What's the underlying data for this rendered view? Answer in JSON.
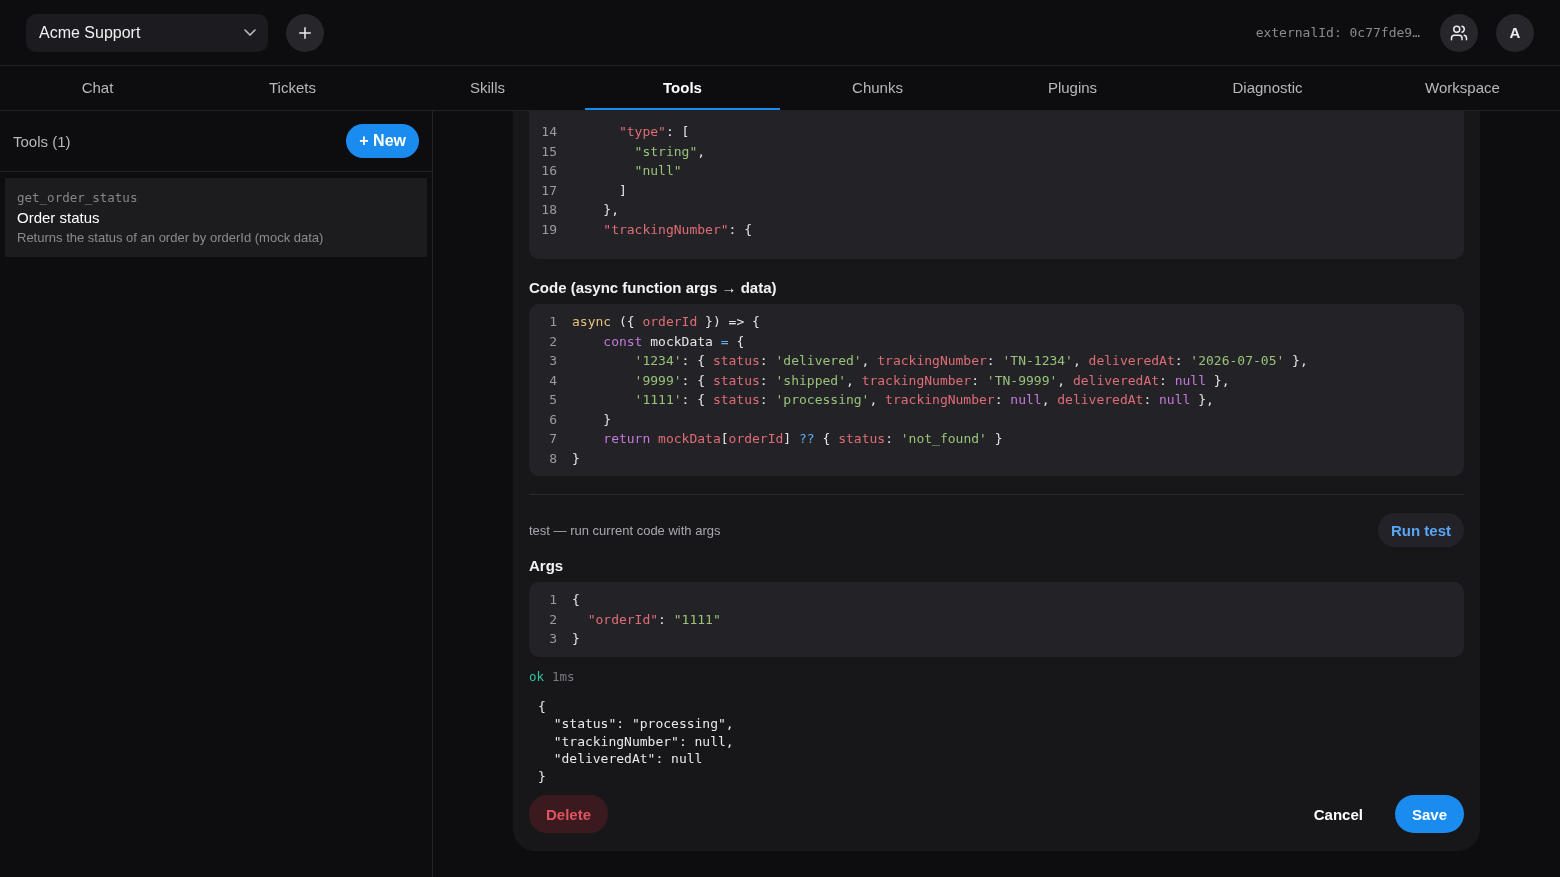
{
  "workspace_select": {
    "value": "Acme Support"
  },
  "external_id": "externalId: 0c77fde9…",
  "avatar": "A",
  "tabs": [
    {
      "label": "Chat",
      "selected": false
    },
    {
      "label": "Tickets",
      "selected": false
    },
    {
      "label": "Skills",
      "selected": false
    },
    {
      "label": "Tools",
      "selected": true
    },
    {
      "label": "Chunks",
      "selected": false
    },
    {
      "label": "Plugins",
      "selected": false
    },
    {
      "label": "Diagnostic",
      "selected": false
    },
    {
      "label": "Workspace",
      "selected": false
    }
  ],
  "sidebar": {
    "title": "Tools (1)",
    "new_button": "+ New",
    "items": [
      {
        "id_text": "get_order_status",
        "name": "Order status",
        "description": "Returns the status of an order by orderId (mock data)",
        "selected": true
      }
    ]
  },
  "schema_editor": {
    "lines": [
      {
        "n": "14",
        "tokens": [
          {
            "kind": "key",
            "text": "      \"type\""
          },
          {
            "kind": "plain",
            "text": ": ["
          }
        ]
      },
      {
        "n": "15",
        "tokens": [
          {
            "kind": "string",
            "text": "        \"string\""
          },
          {
            "kind": "plain",
            "text": ","
          }
        ]
      },
      {
        "n": "16",
        "tokens": [
          {
            "kind": "string",
            "text": "        \"null\""
          }
        ]
      },
      {
        "n": "17",
        "tokens": [
          {
            "kind": "plain",
            "text": "      ]"
          }
        ]
      },
      {
        "n": "18",
        "tokens": [
          {
            "kind": "plain",
            "text": "    },"
          }
        ]
      },
      {
        "n": "19",
        "tokens": [
          {
            "kind": "key",
            "text": "    \"trackingNumber\""
          },
          {
            "kind": "plain",
            "text": ": {"
          }
        ]
      }
    ]
  },
  "code_label": "Code (async function args → data)",
  "code_editor": {
    "lines": [
      {
        "n": "1",
        "tokens": [
          {
            "kind": "async",
            "text": "async"
          },
          {
            "kind": "plain",
            "text": " ({ "
          },
          {
            "kind": "key",
            "text": "orderId"
          },
          {
            "kind": "plain",
            "text": " }) => {"
          }
        ]
      },
      {
        "n": "2",
        "tokens": [
          {
            "kind": "keyword",
            "text": "    const"
          },
          {
            "kind": "plain",
            "text": " mockData "
          },
          {
            "kind": "operator",
            "text": "="
          },
          {
            "kind": "plain",
            "text": " {"
          }
        ]
      },
      {
        "n": "3",
        "tokens": [
          {
            "kind": "string",
            "text": "        '1234'"
          },
          {
            "kind": "plain",
            "text": ": { "
          },
          {
            "kind": "key",
            "text": "status"
          },
          {
            "kind": "plain",
            "text": ": "
          },
          {
            "kind": "string",
            "text": "'delivered'"
          },
          {
            "kind": "plain",
            "text": ", "
          },
          {
            "kind": "key",
            "text": "trackingNumber"
          },
          {
            "kind": "plain",
            "text": ": "
          },
          {
            "kind": "string",
            "text": "'TN-1234'"
          },
          {
            "kind": "plain",
            "text": ", "
          },
          {
            "kind": "key",
            "text": "deliveredAt"
          },
          {
            "kind": "plain",
            "text": ": "
          },
          {
            "kind": "string",
            "text": "'2026-07-05'"
          },
          {
            "kind": "plain",
            "text": " },"
          }
        ]
      },
      {
        "n": "4",
        "tokens": [
          {
            "kind": "string",
            "text": "        '9999'"
          },
          {
            "kind": "plain",
            "text": ": { "
          },
          {
            "kind": "key",
            "text": "status"
          },
          {
            "kind": "plain",
            "text": ": "
          },
          {
            "kind": "string",
            "text": "'shipped'"
          },
          {
            "kind": "plain",
            "text": ", "
          },
          {
            "kind": "key",
            "text": "trackingNumber"
          },
          {
            "kind": "plain",
            "text": ": "
          },
          {
            "kind": "string",
            "text": "'TN-9999'"
          },
          {
            "kind": "plain",
            "text": ", "
          },
          {
            "kind": "key",
            "text": "deliveredAt"
          },
          {
            "kind": "plain",
            "text": ": "
          },
          {
            "kind": "keyword",
            "text": "null"
          },
          {
            "kind": "plain",
            "text": " },"
          }
        ]
      },
      {
        "n": "5",
        "tokens": [
          {
            "kind": "string",
            "text": "        '1111'"
          },
          {
            "kind": "plain",
            "text": ": { "
          },
          {
            "kind": "key",
            "text": "status"
          },
          {
            "kind": "plain",
            "text": ": "
          },
          {
            "kind": "string",
            "text": "'processing'"
          },
          {
            "kind": "plain",
            "text": ", "
          },
          {
            "kind": "key",
            "text": "trackingNumber"
          },
          {
            "kind": "plain",
            "text": ": "
          },
          {
            "kind": "keyword",
            "text": "null"
          },
          {
            "kind": "plain",
            "text": ", "
          },
          {
            "kind": "key",
            "text": "deliveredAt"
          },
          {
            "kind": "plain",
            "text": ": "
          },
          {
            "kind": "keyword",
            "text": "null"
          },
          {
            "kind": "plain",
            "text": " },"
          }
        ]
      },
      {
        "n": "6",
        "tokens": [
          {
            "kind": "plain",
            "text": "    }"
          }
        ]
      },
      {
        "n": "7",
        "tokens": [
          {
            "kind": "keyword",
            "text": "    return"
          },
          {
            "kind": "key",
            "text": " mockData"
          },
          {
            "kind": "plain",
            "text": "["
          },
          {
            "kind": "key",
            "text": "orderId"
          },
          {
            "kind": "plain",
            "text": "] "
          },
          {
            "kind": "operator",
            "text": "??"
          },
          {
            "kind": "plain",
            "text": " { "
          },
          {
            "kind": "key",
            "text": "status"
          },
          {
            "kind": "plain",
            "text": ": "
          },
          {
            "kind": "string",
            "text": "'not_found'"
          },
          {
            "kind": "plain",
            "text": " }"
          }
        ]
      },
      {
        "n": "8",
        "tokens": [
          {
            "kind": "plain",
            "text": "}"
          }
        ]
      }
    ]
  },
  "test": {
    "caption": "test — run current code with args",
    "run_button": "Run test"
  },
  "args_label": "Args",
  "args_editor": {
    "lines": [
      {
        "n": "1",
        "tokens": [
          {
            "kind": "plain",
            "text": "{"
          }
        ]
      },
      {
        "n": "2",
        "tokens": [
          {
            "kind": "key",
            "text": "  \"orderId\""
          },
          {
            "kind": "plain",
            "text": ": "
          },
          {
            "kind": "string",
            "text": "\"1111\""
          }
        ]
      },
      {
        "n": "3",
        "tokens": [
          {
            "kind": "plain",
            "text": "}"
          }
        ]
      }
    ]
  },
  "result": {
    "status": "ok",
    "time": "1ms",
    "output": [
      "{",
      "  \"status\": \"processing\",",
      "  \"trackingNumber\": null,",
      "  \"deliveredAt\": null",
      "}"
    ]
  },
  "footer": {
    "delete": "Delete",
    "cancel": "Cancel",
    "save": "Save"
  }
}
